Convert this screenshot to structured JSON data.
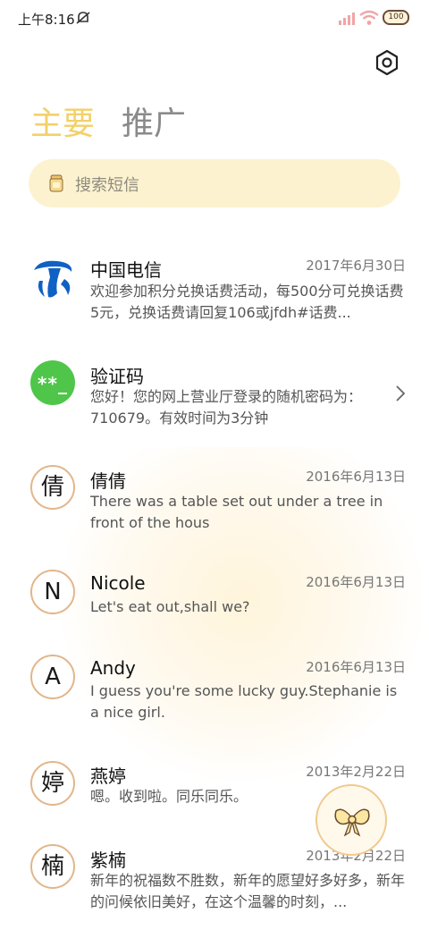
{
  "status_bar": {
    "time": "上午8:16",
    "battery": "100"
  },
  "tabs": [
    {
      "label": "主要",
      "active": true
    },
    {
      "label": "推广",
      "active": false
    }
  ],
  "search": {
    "placeholder": "搜索短信"
  },
  "messages": [
    {
      "sender": "中国电信",
      "date": "2017年6月30日",
      "preview": "欢迎参加积分兑换话费活动，每500分可兑换话费5元，兑换话费请回复106或jfdh#话费...",
      "avatar_type": "telecom-logo"
    },
    {
      "sender": "验证码",
      "date": "",
      "preview": "您好！您的网上营业厅登录的随机密码为：710679。有效时间为3分钟",
      "avatar_text": "**_"
    },
    {
      "sender": "倩倩",
      "date": "2016年6月13日",
      "preview": "There was a table set out under a tree in front of the hous",
      "avatar_text": "倩"
    },
    {
      "sender": "Nicole",
      "date": "2016年6月13日",
      "preview": "Let's eat out,shall we?",
      "avatar_text": "N"
    },
    {
      "sender": "Andy",
      "date": "2016年6月13日",
      "preview": "I guess you're some lucky guy.Stephanie is a nice girl.",
      "avatar_text": "A"
    },
    {
      "sender": "燕婷",
      "date": "2013年2月22日",
      "preview": "嗯。收到啦。同乐同乐。",
      "avatar_text": "婷"
    },
    {
      "sender": "紫楠",
      "date": "2013年2月22日",
      "preview": "新年的祝福数不胜数，新年的愿望好多好多，新年的问候依旧美好，在这个温馨的时刻，...",
      "avatar_text": "楠"
    }
  ],
  "colors": {
    "accent": "#f3d06a",
    "search_bg": "#fdf2cf",
    "avatar_border": "#e2b68a",
    "verify_green": "#4fc64a"
  },
  "icons": {
    "settings": "hexagon-gear-icon",
    "fab": "bow-icon",
    "search": "honey-jar-icon"
  }
}
